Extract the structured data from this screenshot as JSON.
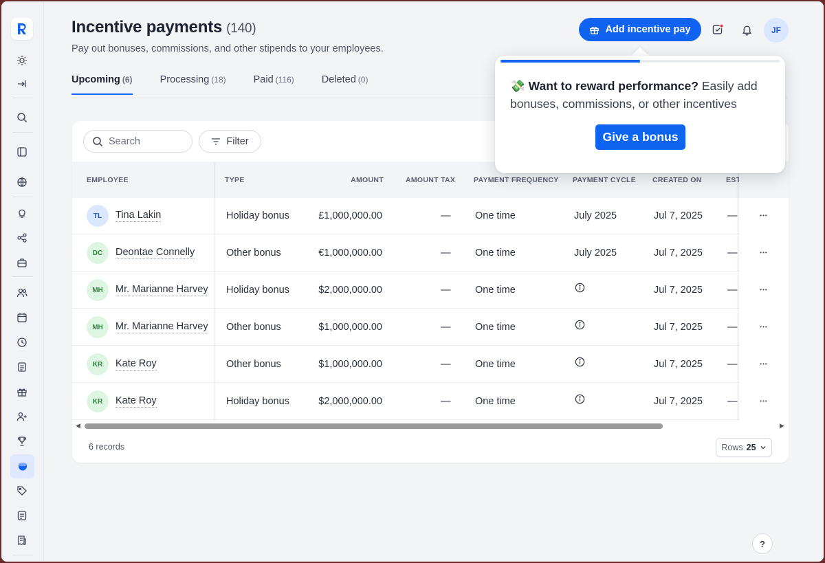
{
  "header": {
    "title": "Incentive payments",
    "count": "(140)",
    "subtitle": "Pay out bonuses, commissions, and other stipends to your employees.",
    "add_button": "Add incentive pay",
    "user_initials": "JF"
  },
  "tabs": [
    {
      "label": "Upcoming",
      "count": "(6)"
    },
    {
      "label": "Processing",
      "count": "(18)"
    },
    {
      "label": "Paid",
      "count": "(116)"
    },
    {
      "label": "Deleted",
      "count": "(0)"
    }
  ],
  "toolbar": {
    "search_placeholder": "Search",
    "filter_label": "Filter"
  },
  "columns": [
    "EMPLOYEE",
    "TYPE",
    "AMOUNT",
    "AMOUNT TAX",
    "PAYMENT FREQUENCY",
    "PAYMENT CYCLE",
    "CREATED ON",
    "EST"
  ],
  "rows": [
    {
      "initials": "TL",
      "name": "Tina Lakin",
      "type": "Holiday bonus",
      "amount": "£1,000,000.00",
      "tax": "—",
      "frequency": "One time",
      "cycle": "July 2025",
      "created": "Jul 7, 2025",
      "est": "—"
    },
    {
      "initials": "DC",
      "name": "Deontae Connelly",
      "type": "Other bonus",
      "amount": "€1,000,000.00",
      "tax": "—",
      "frequency": "One time",
      "cycle": "July 2025",
      "created": "Jul 7, 2025",
      "est": "—"
    },
    {
      "initials": "MH",
      "name": "Mr. Marianne Harvey",
      "type": "Holiday bonus",
      "amount": "$2,000,000.00",
      "tax": "—",
      "frequency": "One time",
      "cycle": "",
      "created": "Jul 7, 2025",
      "est": "—"
    },
    {
      "initials": "MH",
      "name": "Mr. Marianne Harvey",
      "type": "Other bonus",
      "amount": "$1,000,000.00",
      "tax": "—",
      "frequency": "One time",
      "cycle": "",
      "created": "Jul 7, 2025",
      "est": "—"
    },
    {
      "initials": "KR",
      "name": "Kate Roy",
      "type": "Other bonus",
      "amount": "$1,000,000.00",
      "tax": "—",
      "frequency": "One time",
      "cycle": "",
      "created": "Jul 7, 2025",
      "est": "—"
    },
    {
      "initials": "KR",
      "name": "Kate Roy",
      "type": "Holiday bonus",
      "amount": "$2,000,000.00",
      "tax": "—",
      "frequency": "One time",
      "cycle": "",
      "created": "Jul 7, 2025",
      "est": "—"
    }
  ],
  "footer": {
    "records": "6 records",
    "rows_label": "Rows",
    "rows_value": "25"
  },
  "popover": {
    "emoji": "💸",
    "headline": "Want to reward performance?",
    "body": " Easily add bonuses, commissions, or other incentives",
    "button": "Give a bonus",
    "progress": 0.5
  },
  "help_label": "?",
  "colors": {
    "accent": "#1063f0",
    "avatar_blue_bg": "#dbe7ff",
    "avatar_green_bg": "#dff5e3"
  }
}
